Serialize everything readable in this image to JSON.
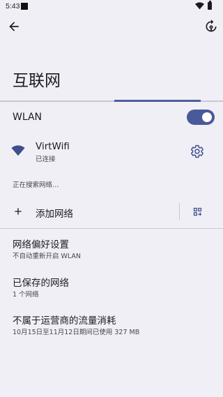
{
  "status_bar": {
    "time": "5:43",
    "wifi_icon": "wifi-icon",
    "battery_icon": "battery-icon"
  },
  "toolbar": {
    "back_icon": "arrow-back-icon",
    "help_icon": "help-feedback-icon"
  },
  "page": {
    "title": "互联网",
    "scan_progress": 0.4
  },
  "wlan": {
    "label": "WLAN",
    "enabled": true
  },
  "connected_network": {
    "name": "VirtWifi",
    "status": "已连接",
    "icon": "wifi-signal-icon",
    "settings_icon": "gear-icon"
  },
  "scan_status": "正在搜索网络…",
  "add_network": {
    "label": "添加网络",
    "icon": "plus-icon",
    "qr_icon": "qr-scan-icon"
  },
  "preferences": [
    {
      "title": "网络偏好设置",
      "summary": "不自动重新开启 WLAN"
    },
    {
      "title": "已保存的网络",
      "summary": "1 个网络"
    },
    {
      "title": "不属于运营商的流量消耗",
      "summary": "10月15日至11月12日期间已使用 327 MB"
    }
  ],
  "colors": {
    "background": "#f1eff6",
    "accent": "#4a5a98",
    "wifi_icon": "#3f4f8c"
  }
}
